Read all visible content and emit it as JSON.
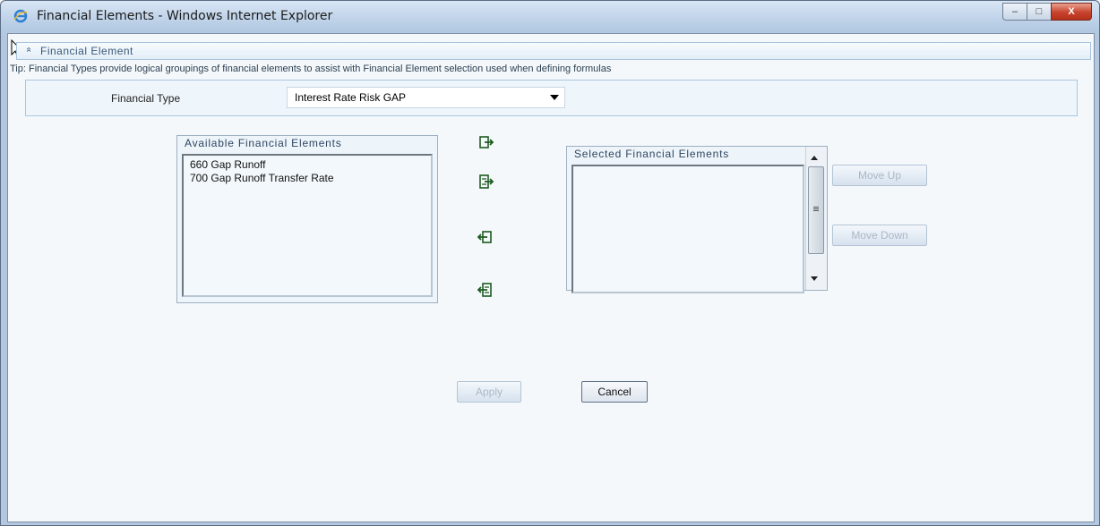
{
  "window": {
    "title": "Financial Elements - Windows Internet Explorer",
    "min_glyph": "–",
    "max_glyph": "□",
    "close_glyph": "X"
  },
  "section": {
    "toggle_glyph": "»",
    "title": "Financial Element",
    "tip": "Tip: Financial Types provide logical groupings of financial elements to assist with Financial Element selection used when defining formulas"
  },
  "financial_type": {
    "label": "Financial Type",
    "selected": "Interest Rate Risk GAP"
  },
  "available": {
    "title": "Available Financial Elements",
    "items": [
      {
        "label": "660  Gap Runoff"
      },
      {
        "label": "700  Gap Runoff Transfer Rate"
      }
    ]
  },
  "selected": {
    "title": "Selected Financial Elements",
    "items": []
  },
  "buttons": {
    "move_up": "Move Up",
    "move_down": "Move Down",
    "apply": "Apply",
    "cancel": "Cancel"
  },
  "icons": {
    "window": "ie-logo-icon",
    "move_right": "move-selected-right-icon",
    "move_all_right": "move-all-right-icon",
    "move_left": "move-selected-left-icon",
    "move_all_left": "move-all-left-icon"
  },
  "colors": {
    "accent": "#3a5877",
    "panel_bg": "#edf4fa",
    "icon_green": "#2f7a32"
  }
}
